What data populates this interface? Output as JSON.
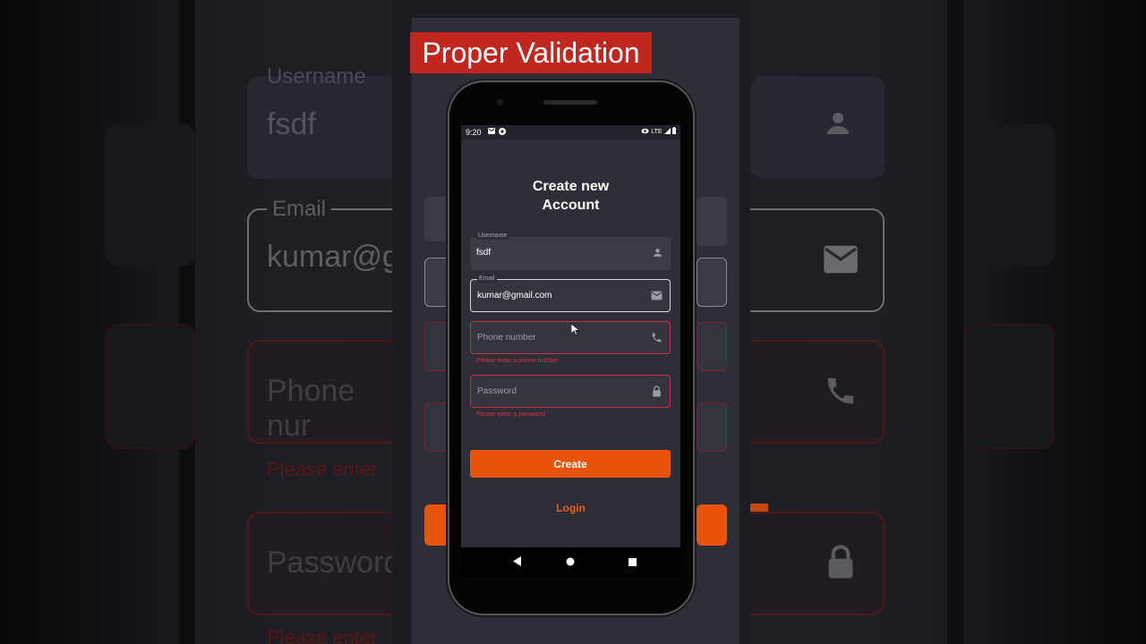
{
  "banner": {
    "text": "Proper Validation"
  },
  "status_bar": {
    "time": "9:20",
    "network": "LTE"
  },
  "screen": {
    "title_line1": "Create new",
    "title_line2": "Account"
  },
  "form": {
    "username": {
      "label": "Username",
      "value": "fsdf",
      "icon": "person-icon"
    },
    "email": {
      "label": "Email",
      "value": "kumar@gmail.com",
      "icon": "mail-icon"
    },
    "phone": {
      "placeholder": "Phone number",
      "error": "Please enter a phone number",
      "icon": "phone-icon"
    },
    "password": {
      "placeholder": "Password",
      "error": "Please enter a password",
      "icon": "lock-icon"
    }
  },
  "actions": {
    "create_label": "Create",
    "login_label": "Login"
  },
  "background_copy": {
    "username_label": "Username",
    "username_value": "fsdf",
    "email_label": "Email",
    "email_value": "kumar@gi",
    "phone_partial": "Phone nur",
    "password_partial": "Password",
    "error_partial": "Please enter",
    "error_partial_bottom": "Please enter"
  },
  "colors": {
    "accent": "#e8540c",
    "error": "#d8323e",
    "screen_bg": "#2d2e37",
    "banner_bg": "#c1271e"
  }
}
